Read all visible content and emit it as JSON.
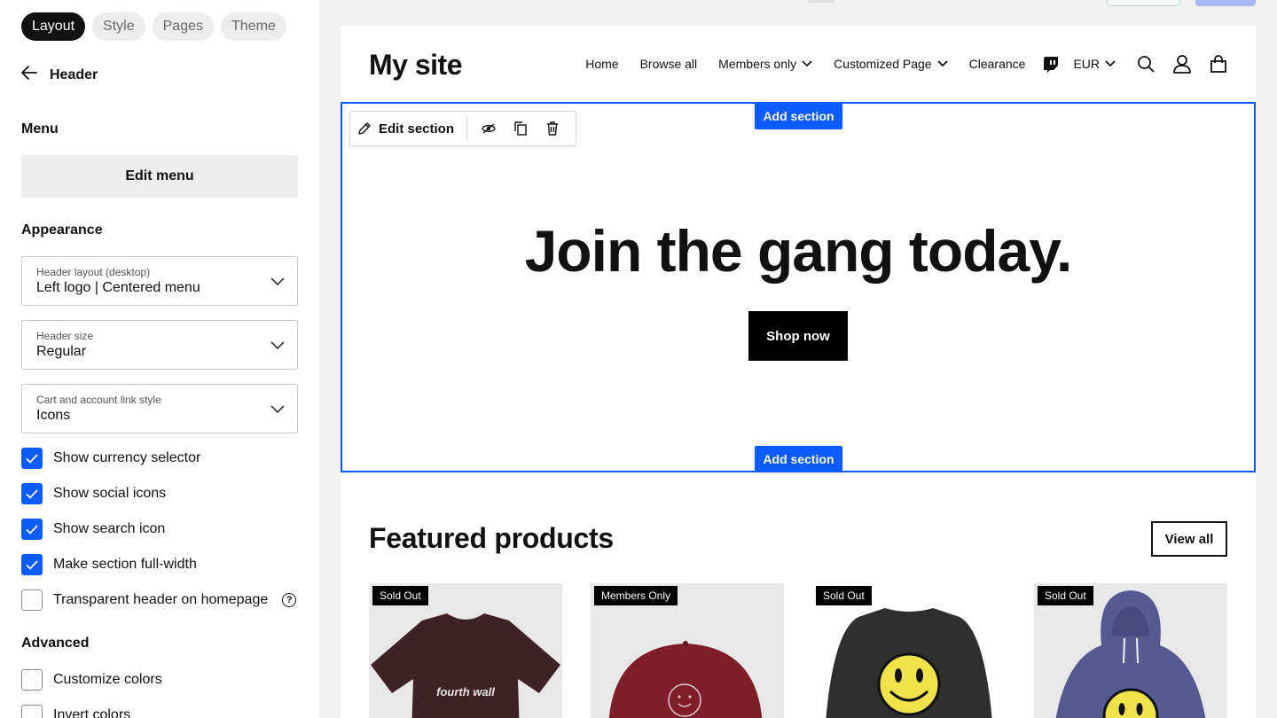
{
  "sidebar": {
    "tabs": [
      {
        "label": "Layout",
        "active": true
      },
      {
        "label": "Style",
        "active": false
      },
      {
        "label": "Pages",
        "active": false
      },
      {
        "label": "Theme",
        "active": false
      }
    ],
    "back_label": "Header",
    "menu_title": "Menu",
    "edit_menu_label": "Edit menu",
    "appearance_title": "Appearance",
    "selects": [
      {
        "caption": "Header layout (desktop)",
        "value": "Left logo | Centered menu"
      },
      {
        "caption": "Header size",
        "value": "Regular"
      },
      {
        "caption": "Cart and account link style",
        "value": "Icons"
      }
    ],
    "checkboxes": [
      {
        "label": "Show currency selector",
        "checked": true
      },
      {
        "label": "Show social icons",
        "checked": true
      },
      {
        "label": "Show search icon",
        "checked": true
      },
      {
        "label": "Make section full-width",
        "checked": true
      },
      {
        "label": "Transparent header on homepage",
        "checked": false
      }
    ],
    "help_glyph": "?",
    "advanced_title": "Advanced",
    "advanced_checkboxes": [
      {
        "label": "Customize colors",
        "checked": false
      },
      {
        "label": "Invert colors",
        "checked": false
      }
    ]
  },
  "site": {
    "logo": "My site",
    "nav": [
      {
        "label": "Home"
      },
      {
        "label": "Browse all"
      },
      {
        "label": "Members only",
        "dropdown": true
      },
      {
        "label": "Customized Page",
        "dropdown": true
      },
      {
        "label": "Clearance"
      }
    ],
    "currency": "EUR",
    "icons": [
      "twitch-icon",
      "search-icon",
      "account-icon",
      "cart-icon"
    ]
  },
  "hero": {
    "toolbar_edit_label": "Edit section",
    "add_section_label": "Add section",
    "title": "Join the gang today.",
    "cta_label": "Shop now"
  },
  "featured": {
    "title": "Featured products",
    "view_all_label": "View all",
    "products": [
      {
        "badge": "Sold Out",
        "image": "tshirt-fourthwall",
        "shirt_text": "fourth wall"
      },
      {
        "badge": "Members Only",
        "image": "red-cap"
      },
      {
        "badge": "Sold Out",
        "image": "smiley-sweatshirt"
      },
      {
        "badge": "Sold Out",
        "image": "smiley-hoodie"
      }
    ]
  },
  "colors": {
    "accent": "#0a5cff",
    "text": "#111111",
    "sidebar_bg": "#ffffff",
    "canvas_bg": "#f1f1f1"
  }
}
